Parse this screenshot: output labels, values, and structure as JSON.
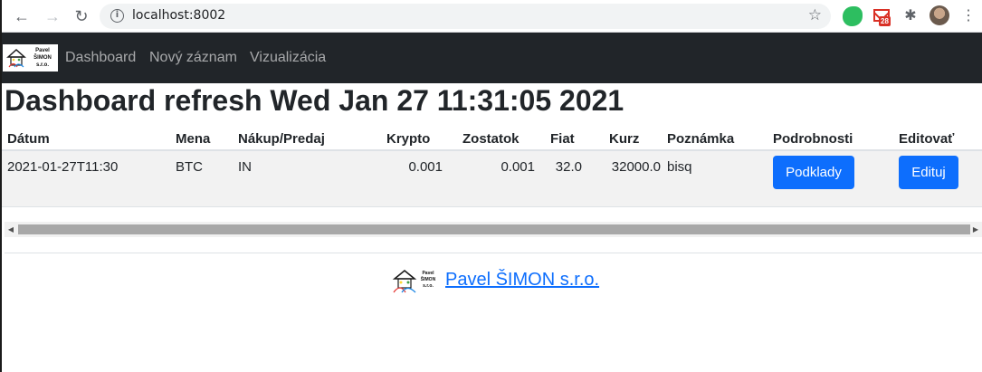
{
  "browser": {
    "url": "localhost:8002",
    "gmail_badge": "28"
  },
  "navbar": {
    "brand_lines": [
      "Pavel",
      "ŠIMON",
      "s.r.o."
    ],
    "links": [
      "Dashboard",
      "Nový záznam",
      "Vizualizácia"
    ]
  },
  "page": {
    "title": "Dashboard refresh Wed Jan 27 11:31:05 2021"
  },
  "table": {
    "headers": [
      "Dátum",
      "Mena",
      "Nákup/Predaj",
      "Krypto",
      "Zostatok",
      "Fiat",
      "Kurz",
      "Poznámka",
      "Podrobnosti",
      "Editovať"
    ],
    "rows": [
      {
        "datum": "2021-01-27T11:30",
        "mena": "BTC",
        "nakup_predaj": "IN",
        "krypto": "0.001",
        "zostatok": "0.001",
        "fiat": "32.0",
        "kurz": "32000.0",
        "poznamka": "bisq",
        "podrobnosti_label": "Podklady",
        "editovat_label": "Edituj"
      }
    ]
  },
  "footer": {
    "logo_lines": [
      "Pavel",
      "ŠIMON",
      "s.r.o."
    ],
    "link_text": " Pavel ŠIMON s.r.o."
  },
  "colors": {
    "navbar_bg": "#212529",
    "primary": "#0d6efd",
    "row_stripe": "#f2f2f2"
  }
}
